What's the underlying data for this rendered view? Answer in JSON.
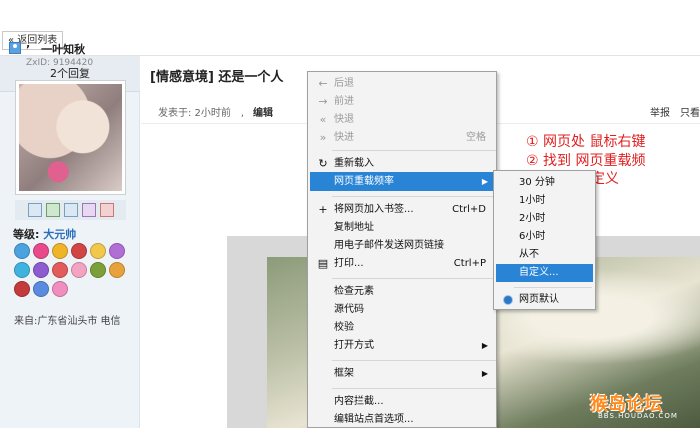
{
  "topbar": {
    "back_label": "« 返回列表"
  },
  "sidebar": {
    "reply_count": "2个回复",
    "username": "’　一叶知秋",
    "zxid": "ZxID:  9194420",
    "level_label": "等级:",
    "level_value": "大元帅",
    "location": "来自:广东省汕头市 电信"
  },
  "post": {
    "title": "[情感意境] 还是一个人",
    "posted": "发表于: 2小时前　,",
    "edit": "编辑",
    "report": "举报",
    "only_view": "只看"
  },
  "annotations": {
    "line1": "①  网页处  鼠标右键",
    "line2": "②    找到  网页重载频",
    "line3": "率  选择  自定义"
  },
  "context_menu": {
    "back": "后退",
    "forward": "前进",
    "fast_back": "快退",
    "fast_forward": "快进",
    "space": "空格",
    "reload": "重新载入",
    "reload_freq": "网页重载频率",
    "bookmark": "将网页加入书签...",
    "bookmark_shortcut": "Ctrl+D",
    "copy_address": "复制地址",
    "email_link": "用电子邮件发送网页链接",
    "print": "打印...",
    "print_shortcut": "Ctrl+P",
    "inspect": "检查元素",
    "source": "源代码",
    "validate": "校验",
    "open_with": "打开方式",
    "frame": "框架",
    "block_content": "内容拦截...",
    "site_prefs": "编辑站点首选项..."
  },
  "submenu": {
    "items": [
      "30 分钟",
      "1小时",
      "2小时",
      "6小时",
      "从不",
      "自定义...",
      "网页默认"
    ]
  },
  "watermark": {
    "main": "猴岛论坛",
    "sub": "BBS.HOUDAO.COM"
  }
}
